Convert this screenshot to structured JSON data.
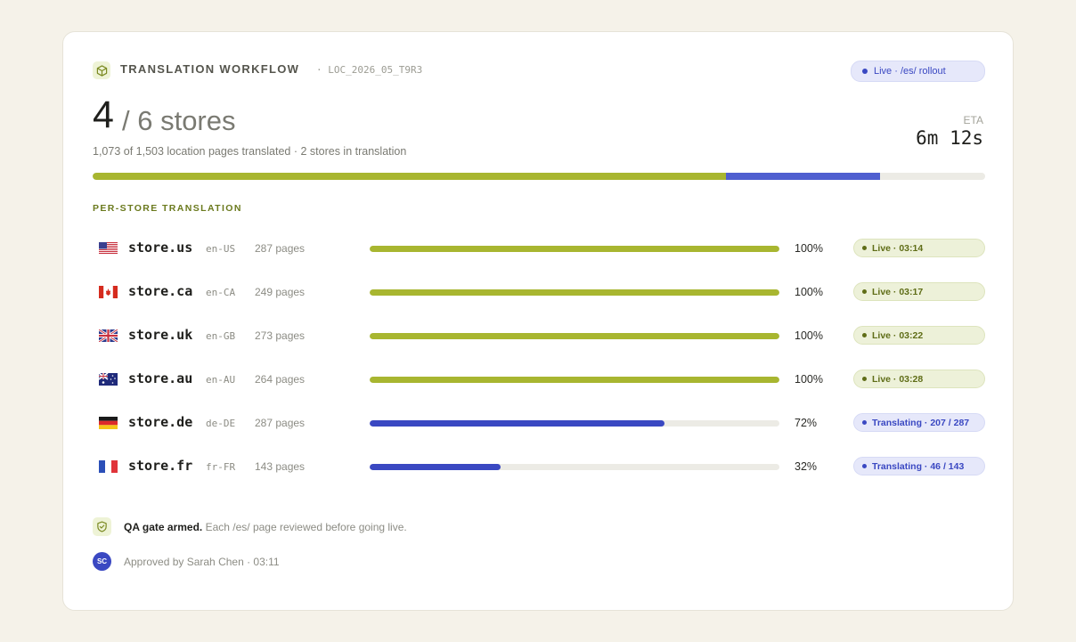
{
  "header": {
    "title": "TRANSLATION WORKFLOW",
    "run_id": "· LOC_2026_05_T9R3",
    "status_pill": "Live · /es/ rollout",
    "icon": "cube-icon"
  },
  "summary": {
    "completed": "4",
    "total_text": "/ 6 stores",
    "detail": "1,073 of 1,503 location pages translated · 2 stores in translation",
    "eta_label": "ETA",
    "eta_value": "6m 12s",
    "overall_done_fraction": 0.71,
    "overall_inprogress_fraction": 0.172
  },
  "section_title": "PER-STORE TRANSLATION",
  "stores": [
    {
      "flag": "us",
      "name": "store.us",
      "locale": "en-US",
      "pages": "287 pages",
      "percent": 100,
      "percent_label": "100%",
      "status": "live",
      "status_label": "Live · 03:14"
    },
    {
      "flag": "ca",
      "name": "store.ca",
      "locale": "en-CA",
      "pages": "249 pages",
      "percent": 100,
      "percent_label": "100%",
      "status": "live",
      "status_label": "Live · 03:17"
    },
    {
      "flag": "gb",
      "name": "store.uk",
      "locale": "en-GB",
      "pages": "273 pages",
      "percent": 100,
      "percent_label": "100%",
      "status": "live",
      "status_label": "Live · 03:22"
    },
    {
      "flag": "au",
      "name": "store.au",
      "locale": "en-AU",
      "pages": "264 pages",
      "percent": 100,
      "percent_label": "100%",
      "status": "live",
      "status_label": "Live · 03:28"
    },
    {
      "flag": "de",
      "name": "store.de",
      "locale": "de-DE",
      "pages": "287 pages",
      "percent": 72,
      "percent_label": "72%",
      "status": "translating",
      "status_label": "Translating · 207 / 287"
    },
    {
      "flag": "fr",
      "name": "store.fr",
      "locale": "fr-FR",
      "pages": "143 pages",
      "percent": 32,
      "percent_label": "32%",
      "status": "translating",
      "status_label": "Translating · 46 / 143"
    }
  ],
  "footer": {
    "qa_bold": "QA gate armed.",
    "qa_rest": " Each /es/ page reviewed before going live.",
    "avatar_initials": "SC",
    "approved_text": "Approved by Sarah Chen · 03:11"
  },
  "colors": {
    "done": "#a8b630",
    "in_progress": "#3a48c2",
    "track": "#ecebe5"
  }
}
